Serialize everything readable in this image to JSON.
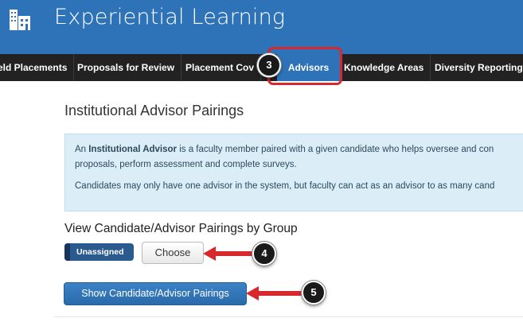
{
  "header": {
    "app_title": "Experiential Learning",
    "logo_icon": "building-icon",
    "background_color": "#2e73b8"
  },
  "tabs": [
    {
      "label": "eld Placements",
      "active": false
    },
    {
      "label": "Proposals for Review",
      "active": false
    },
    {
      "label": "Placement Cov",
      "active": false
    },
    {
      "label": "Advisors",
      "active": true
    },
    {
      "label": "Knowledge Areas",
      "active": false
    },
    {
      "label": "Diversity Reporting",
      "active": false
    }
  ],
  "callouts": {
    "step3": "3",
    "step4": "4",
    "step5": "5"
  },
  "main": {
    "page_title": "Institutional Advisor Pairings",
    "info": {
      "line1_prefix": "An ",
      "line1_bold": "Institutional Advisor",
      "line1_rest": " is a faculty member paired with a given candidate who helps oversee and con",
      "line2": "proposals, perform assessment and complete surveys.",
      "line3": "Candidates may only have one advisor in the system, but faculty can act as an advisor to as many cand"
    },
    "section_title": "View Candidate/Advisor Pairings by Group",
    "group_chip_label": "Unassigned",
    "choose_button_label": "Choose",
    "show_button_label": "Show Candidate/Advisor Pairings"
  },
  "colors": {
    "accent": "#2e73b8",
    "nav_bg": "#222222",
    "annotation_red": "#d9272e",
    "info_bg": "#dbeef8"
  }
}
